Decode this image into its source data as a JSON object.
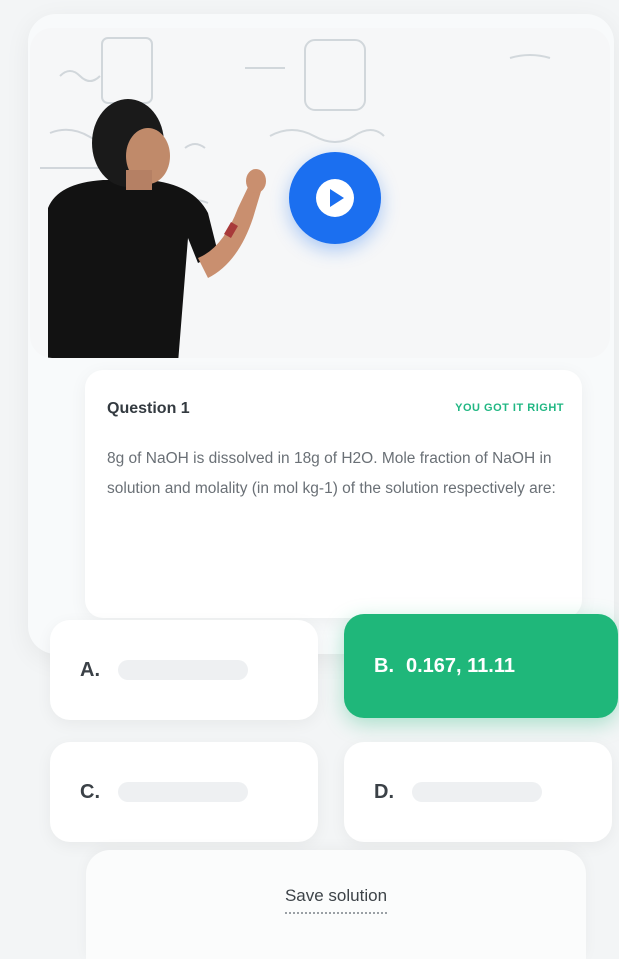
{
  "question": {
    "title": "Question 1",
    "status": "YOU GOT IT RIGHT",
    "text": "8g of NaOH is dissolved in 18g of H2O. Mole fraction of NaOH in solution and molality (in mol kg-1) of the solution respectively are:"
  },
  "options": [
    {
      "letter": "A.",
      "value": ""
    },
    {
      "letter": "B.",
      "value": "0.167, 11.11"
    },
    {
      "letter": "C.",
      "value": ""
    },
    {
      "letter": "D.",
      "value": ""
    }
  ],
  "actions": {
    "save_label": "Save solution"
  },
  "colors": {
    "accent_blue": "#1b6ff0",
    "correct_green": "#1fb77a"
  },
  "icons": {
    "play": "play-icon"
  }
}
